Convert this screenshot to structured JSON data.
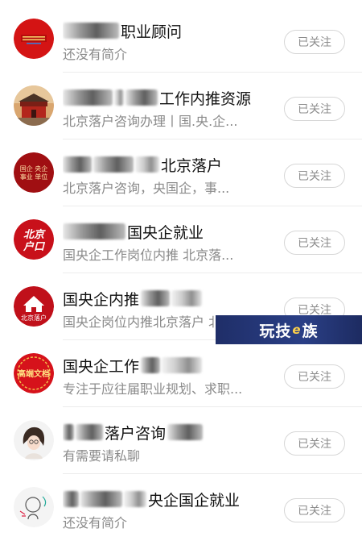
{
  "follow_label": "已关注",
  "watermark": {
    "part1": "玩技",
    "e": "e",
    "part2": "族"
  },
  "items": [
    {
      "title": "职业顾问",
      "subtitle": "还没有简介"
    },
    {
      "title": "工作内推资源",
      "subtitle": "北京落户咨询办理丨国.央.企..."
    },
    {
      "title": "北京落户",
      "subtitle": "北京落户咨询，央国企，事..."
    },
    {
      "title": "国央企就业",
      "subtitle": "国央企工作岗位内推 北京落..."
    },
    {
      "title": "国央企内推",
      "subtitle": "国央企岗位内推北京落户 北..."
    },
    {
      "title": "国央企工作",
      "subtitle": "专注于应往届职业规划、求职..."
    },
    {
      "title": "落户咨询",
      "subtitle": "有需要请私聊"
    },
    {
      "title": "央企国企就业",
      "subtitle": "还没有简介"
    }
  ],
  "avatars": [
    {
      "icon": "red-banner-logo-icon",
      "bg": "#d41414"
    },
    {
      "icon": "tiananmen-photo-icon",
      "bg": "#c98a52"
    },
    {
      "icon": "guoqi-shiye-danwei-icon",
      "bg": "#a00f12",
      "text": "国企 央企 事业 单位"
    },
    {
      "icon": "beijing-hukou-icon",
      "bg": "#c8101a",
      "text_top": "北京",
      "text_bottom": "户口"
    },
    {
      "icon": "house-beijing-luohu-icon",
      "bg": "#c0101a",
      "text": "北京落户"
    },
    {
      "icon": "calligraphy-stamp-icon",
      "bg": "#d6121b",
      "text": "高端文档"
    },
    {
      "icon": "cartoon-girl-portrait-icon",
      "bg": "#f3f3f3"
    },
    {
      "icon": "cartoon-figure-icon",
      "bg": "#f4f4f4"
    }
  ]
}
